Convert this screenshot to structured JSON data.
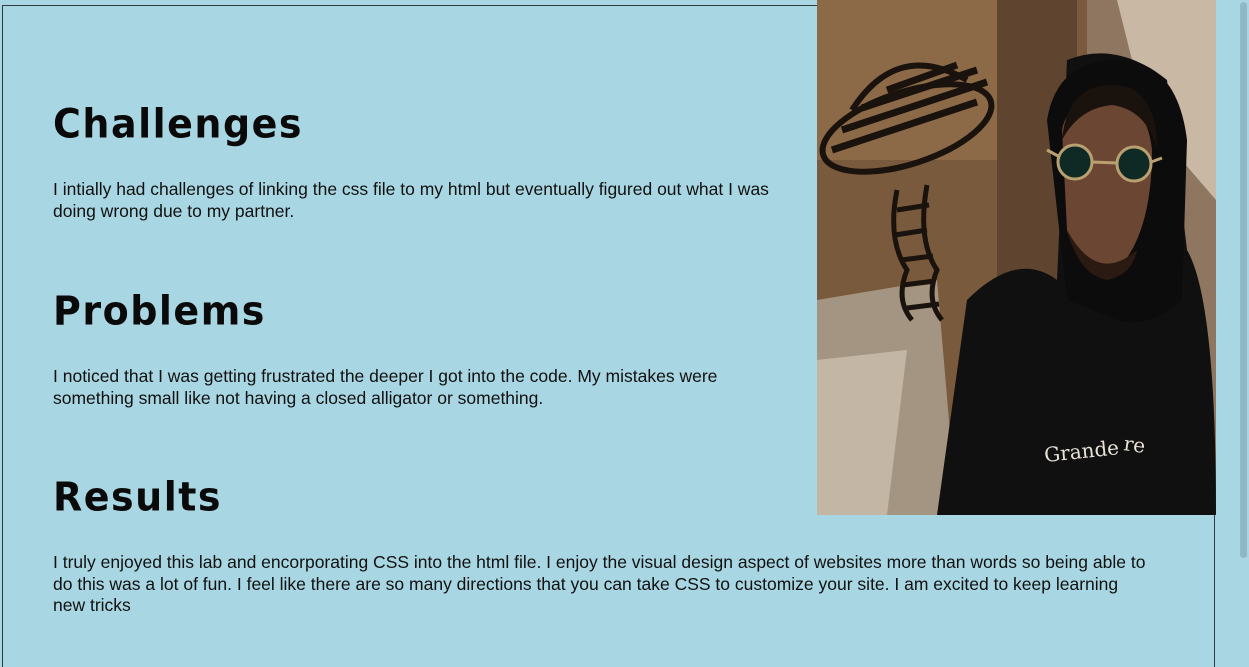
{
  "sections": [
    {
      "heading": "Challenges",
      "text": "I intially had challenges of linking the css file to my html but eventually figured out what I was doing wrong due to my partner."
    },
    {
      "heading": "Problems",
      "text": "I noticed that I was getting frustrated the deeper I got into the code. My mistakes were something small like not having a closed alligator or something."
    },
    {
      "heading": "Results",
      "text": "I truly enjoyed this lab and encorporating CSS into the html file. I enjoy the visual design aspect of websites more than words so being able to do this was a lot of fun. I feel like there are so many directions that you can take CSS to customize your site. I am excited to keep learning new tricks"
    }
  ],
  "photo": {
    "hoodie_text": "Grande"
  },
  "colors": {
    "background": "#a8d6e3",
    "text": "#111111",
    "heading": "#0a0a0a"
  }
}
